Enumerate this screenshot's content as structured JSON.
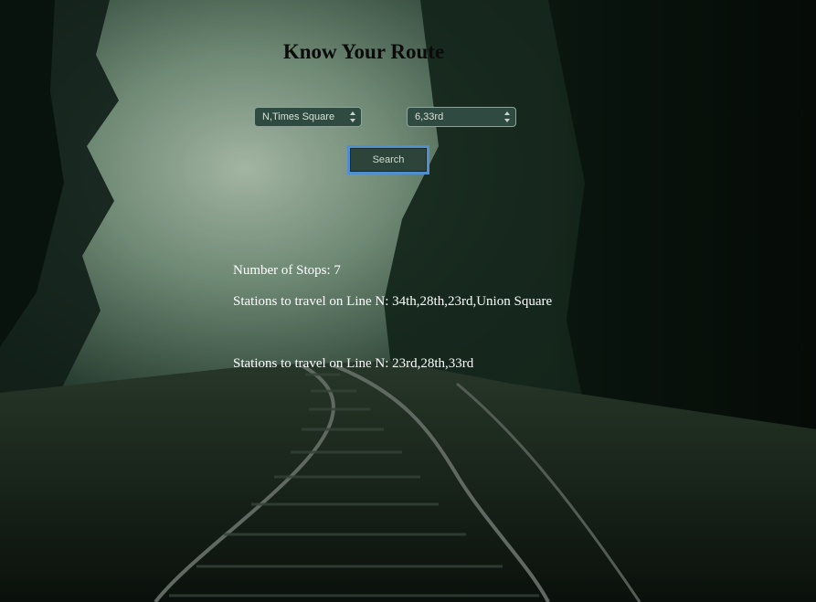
{
  "page": {
    "title": "Know Your Route"
  },
  "form": {
    "from_select": {
      "selected": "N,Times Square"
    },
    "to_select": {
      "selected": "6,33rd"
    },
    "search_label": "Search"
  },
  "results": {
    "stops_label": "Number of Stops: 7",
    "segments": [
      "Stations to travel on Line N: 34th,28th,23rd,Union Square",
      "Stations to travel on Line N: 23rd,28th,33rd"
    ]
  },
  "theme": {
    "select_bg": "#2f4a40",
    "button_focus_ring": "#4f8fd0",
    "text_light": "#ffffff",
    "title_color": "#0b0b0b"
  },
  "icons": {
    "select_arrow": "up-down-arrows-icon",
    "background": "forest-railway-photo"
  }
}
